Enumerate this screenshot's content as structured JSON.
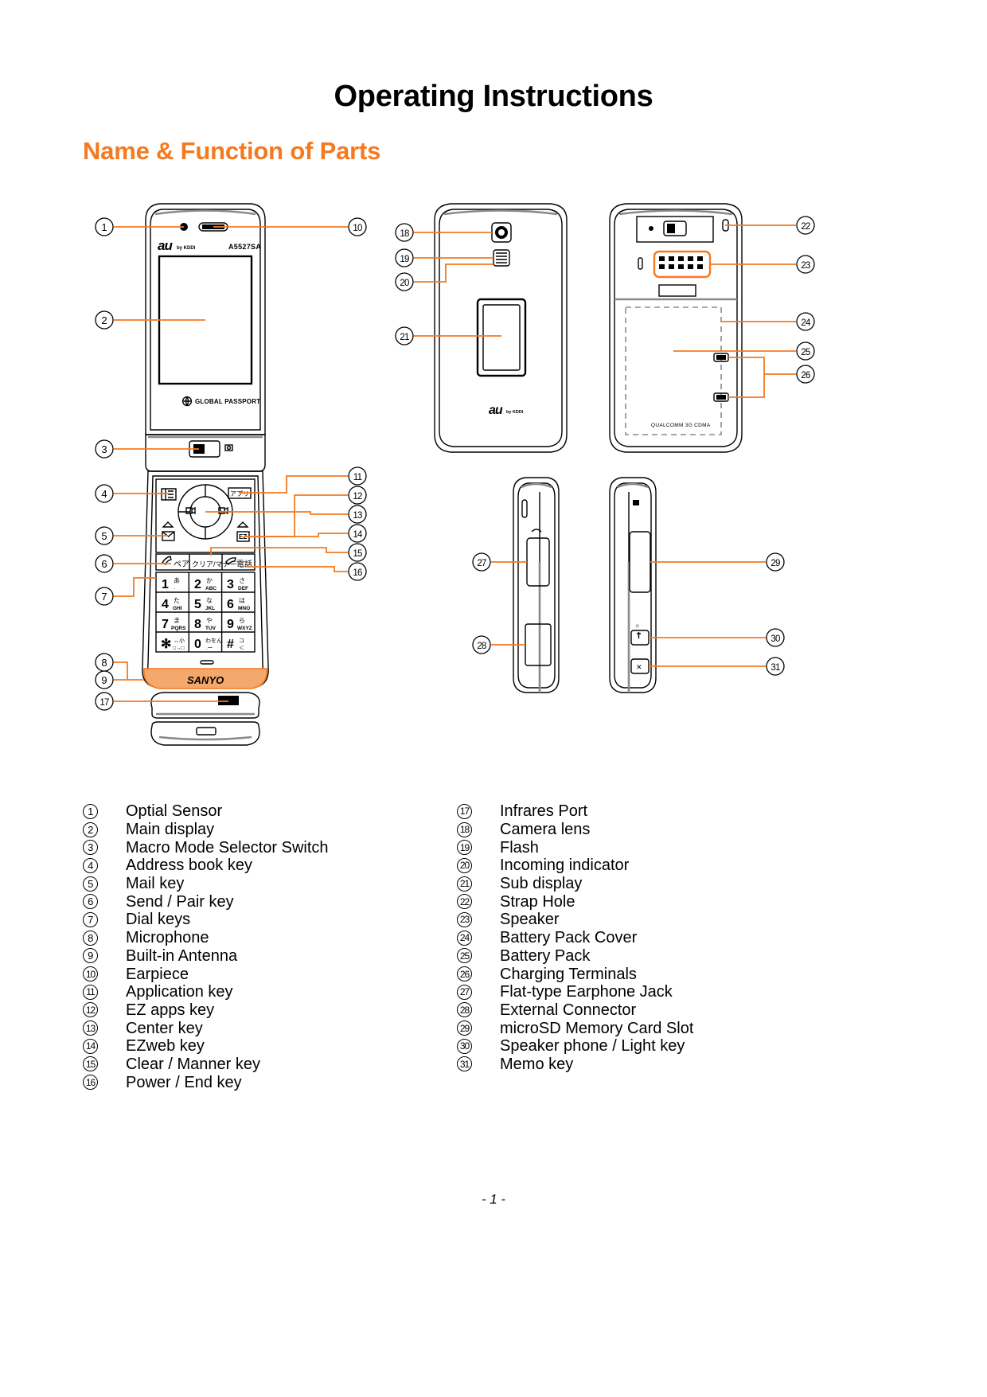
{
  "document": {
    "title": "Operating Instructions",
    "section_title": "Name & Function of Parts",
    "page_number": "- 1 -",
    "accent_color": "#F47A20"
  },
  "device": {
    "brand_logo": "au",
    "brand_sub": "by KDDI",
    "model_number": "A5527SA",
    "front_badge": "GLOBAL PASSPORT",
    "back_badge": "QUALCOMM 3G CDMA",
    "maker_logo": "SANYO",
    "back_logo": "au"
  },
  "keypad": {
    "softkeys": [
      {
        "name": "send-pair",
        "label": "ペア"
      },
      {
        "name": "clear-manner",
        "label": "クリア/マナー"
      },
      {
        "name": "power-end",
        "label": "電話"
      }
    ],
    "keys": [
      {
        "digit": "1",
        "kana": "あ",
        "latin": "."
      },
      {
        "digit": "2",
        "kana": "か",
        "latin": "ABC"
      },
      {
        "digit": "3",
        "kana": "さ",
        "latin": "DEF"
      },
      {
        "digit": "4",
        "kana": "た",
        "latin": "GHI"
      },
      {
        "digit": "5",
        "kana": "な",
        "latin": "JKL"
      },
      {
        "digit": "6",
        "kana": "は",
        "latin": "MNO"
      },
      {
        "digit": "7",
        "kana": "ま",
        "latin": "PQRS"
      },
      {
        "digit": "8",
        "kana": "や",
        "latin": "TUV"
      },
      {
        "digit": "9",
        "kana": "ら",
        "latin": "WXYZ"
      },
      {
        "digit": "✕",
        "kana": "わ小",
        "latin": "□→□"
      },
      {
        "digit": "0",
        "kana": "わをん",
        "latin": ".ー"
      },
      {
        "digit": "#",
        "kana": "コ",
        "latin": "＜"
      }
    ]
  },
  "callouts": [
    {
      "n": "1",
      "view": "front"
    },
    {
      "n": "2",
      "view": "front"
    },
    {
      "n": "3",
      "view": "front"
    },
    {
      "n": "4",
      "view": "front"
    },
    {
      "n": "5",
      "view": "front"
    },
    {
      "n": "6",
      "view": "front"
    },
    {
      "n": "7",
      "view": "front"
    },
    {
      "n": "8",
      "view": "front"
    },
    {
      "n": "9",
      "view": "front"
    },
    {
      "n": "10",
      "view": "front"
    },
    {
      "n": "11",
      "view": "front"
    },
    {
      "n": "12",
      "view": "front"
    },
    {
      "n": "13",
      "view": "front"
    },
    {
      "n": "14",
      "view": "front"
    },
    {
      "n": "15",
      "view": "front"
    },
    {
      "n": "16",
      "view": "front"
    },
    {
      "n": "17",
      "view": "top"
    },
    {
      "n": "18",
      "view": "rear-closed"
    },
    {
      "n": "19",
      "view": "rear-closed"
    },
    {
      "n": "20",
      "view": "rear-closed"
    },
    {
      "n": "21",
      "view": "rear-closed"
    },
    {
      "n": "22",
      "view": "rear-open"
    },
    {
      "n": "23",
      "view": "rear-open"
    },
    {
      "n": "24",
      "view": "rear-open"
    },
    {
      "n": "25",
      "view": "rear-open"
    },
    {
      "n": "26",
      "view": "rear-open"
    },
    {
      "n": "27",
      "view": "side-left"
    },
    {
      "n": "28",
      "view": "side-left"
    },
    {
      "n": "29",
      "view": "side-right"
    },
    {
      "n": "30",
      "view": "side-right"
    },
    {
      "n": "31",
      "view": "side-right"
    }
  ],
  "legend": {
    "left": [
      {
        "num": "1",
        "label": "Optial Sensor"
      },
      {
        "num": "2",
        "label": "Main display"
      },
      {
        "num": "3",
        "label": "Macro Mode Selector Switch"
      },
      {
        "num": "4",
        "label": "Address book key"
      },
      {
        "num": "5",
        "label": "Mail key"
      },
      {
        "num": "6",
        "label": "Send / Pair key"
      },
      {
        "num": "7",
        "label": "Dial keys"
      },
      {
        "num": "8",
        "label": "Microphone"
      },
      {
        "num": "9",
        "label": "Built-in Antenna"
      },
      {
        "num": "10",
        "label": "Earpiece"
      },
      {
        "num": "11",
        "label": "Application key"
      },
      {
        "num": "12",
        "label": "EZ apps key"
      },
      {
        "num": "13",
        "label": "Center key"
      },
      {
        "num": "14",
        "label": "EZweb key"
      },
      {
        "num": "15",
        "label": "Clear / Manner key"
      },
      {
        "num": "16",
        "label": "Power / End key"
      }
    ],
    "right": [
      {
        "num": "17",
        "label": "Infrares Port"
      },
      {
        "num": "18",
        "label": "Camera lens"
      },
      {
        "num": "19",
        "label": "Flash"
      },
      {
        "num": "20",
        "label": "Incoming indicator"
      },
      {
        "num": "21",
        "label": "Sub display"
      },
      {
        "num": "22",
        "label": "Strap Hole"
      },
      {
        "num": "23",
        "label": "Speaker"
      },
      {
        "num": "24",
        "label": "Battery Pack Cover"
      },
      {
        "num": "25",
        "label": "Battery Pack"
      },
      {
        "num": "26",
        "label": "Charging Terminals"
      },
      {
        "num": "27",
        "label": "Flat-type Earphone Jack"
      },
      {
        "num": "28",
        "label": "External Connector"
      },
      {
        "num": "29",
        "label": "microSD Memory Card Slot"
      },
      {
        "num": "30",
        "label": "Speaker phone / Light key"
      },
      {
        "num": "31",
        "label": "Memo key"
      }
    ]
  }
}
